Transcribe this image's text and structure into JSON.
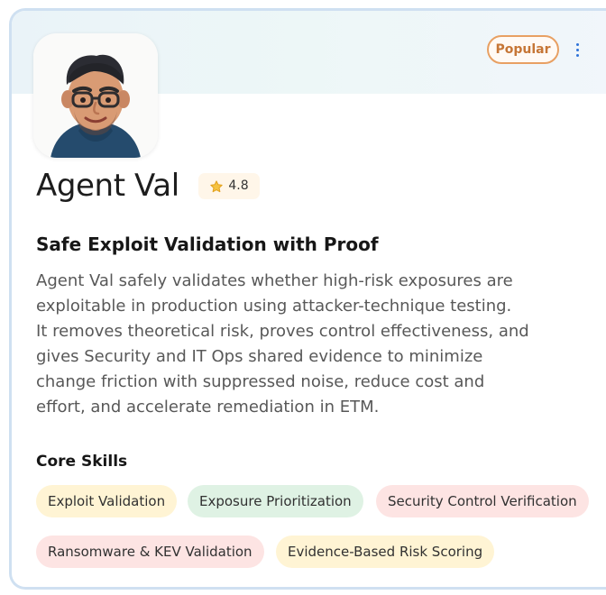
{
  "badge": {
    "label": "Popular"
  },
  "menu": {
    "icon": "vertical-more-icon"
  },
  "agent": {
    "name": "Agent Val",
    "rating": "4.8",
    "avatar_icon": "cartoon-man-avatar",
    "headline": "Safe Exploit Validation with Proof",
    "description": [
      "Agent Val safely validates whether high-risk exposures are",
      "exploitable in production using attacker-technique testing.",
      "It removes theoretical risk, proves control effectiveness, and",
      "gives Security and IT Ops shared evidence to minimize",
      "change friction with suppressed noise, reduce cost and",
      "effort, and accelerate remediation in ETM."
    ]
  },
  "skills": {
    "title": "Core Skills",
    "items": [
      "Exploit Validation",
      "Exposure Prioritization",
      "Security Control Verification",
      "Ransomware & KEV Validation",
      "Evidence-Based Risk Scoring"
    ]
  },
  "colors": {
    "card_border": "#cfe0f1",
    "popular_accent": "#e8a063",
    "menu_accent": "#2f73d9",
    "skill_yellow": "#fff4d4",
    "skill_green": "#dff2e4",
    "skill_pink": "#fde4e3"
  }
}
